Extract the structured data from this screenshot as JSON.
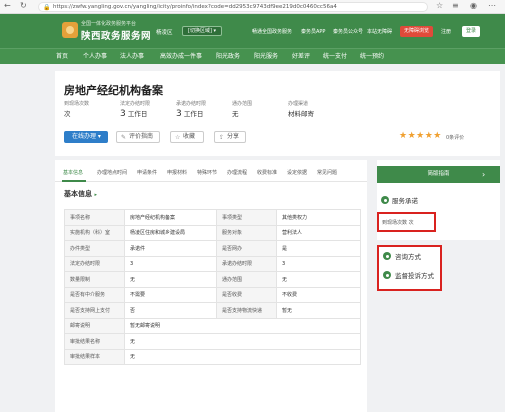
{
  "browser": {
    "url": "https://zwfw.yangling.gov.cn/yangling/icity/proinfo/index?code=dd2953c9743df9ee219d0c0460cc56a4",
    "back_icon": "arrow-left-icon",
    "refresh_icon": "refresh-icon"
  },
  "header": {
    "site_subtitle": "全国一体化政务服务平台",
    "site_name": "陕西政务服务网",
    "region": "杨凌区",
    "region_switch": "[切换区域] ▾",
    "links": [
      "畅通全国政务服务",
      "秦务员APP",
      "秦务员公众号",
      "本站无障碍"
    ],
    "alert_button": "无障碍浏览",
    "register": "注册",
    "login": "登录",
    "brand_color": "#3f8a4a"
  },
  "nav": {
    "items": [
      "首页",
      "个人办事",
      "法人办事",
      "高效办成一件事",
      "阳光政务",
      "阳光服务",
      "好差评",
      "统一支付",
      "统一预约"
    ]
  },
  "item": {
    "title": "房地产经纪机构备案",
    "stats": [
      {
        "label": "到现场次数",
        "value": "",
        "unit": "次"
      },
      {
        "label": "法定办结时限",
        "value": "3",
        "unit": "工作日"
      },
      {
        "label": "承诺办结时限",
        "value": "3",
        "unit": "工作日"
      },
      {
        "label": "通办范围",
        "value": "",
        "unit": "无"
      },
      {
        "label": "办理渠道",
        "value": "",
        "unit": "材料邮寄"
      }
    ],
    "buttons": {
      "online": "在线办理 ▾",
      "evaluate": "评价指南",
      "favorite": "收藏",
      "share": "分享"
    },
    "stars": "★★★★★",
    "rating_text": "0条评价"
  },
  "tabs": [
    "基本信息",
    "办理地点时间",
    "申请条件",
    "申报材料",
    "特殊环节",
    "办理流程",
    "收费标准",
    "设定依据",
    "常见问题"
  ],
  "basic_info": {
    "title": "基本信息",
    "rows": [
      [
        "事项名称",
        "房地产经纪机构备案",
        "事项类型",
        "其他类权力"
      ],
      [
        "实施机构（科）室",
        "杨凌区住房和城乡建设局",
        "服务对象",
        "营利法人"
      ],
      [
        "办件类型",
        "承诺件",
        "是否网办",
        "是"
      ],
      [
        "法定办结时限",
        "3",
        "承诺办结时限",
        "3"
      ],
      [
        "数量限制",
        "无",
        "通办范围",
        "无"
      ],
      [
        "是否有中介服务",
        "不需要",
        "是否收费",
        "不收费"
      ],
      [
        "是否支持网上支付",
        "否",
        "是否支持物流快递",
        "暂无"
      ],
      [
        "邮寄说明",
        "暂无邮寄说明",
        "",
        ""
      ],
      [
        "审批结果名称",
        "无",
        "",
        ""
      ],
      [
        "审批结果样本",
        "无",
        "",
        ""
      ]
    ]
  },
  "sidebar": {
    "guide": "简版指南",
    "service_title": "服务承诺",
    "visit_text": "到现场次数 次",
    "consult": "咨询方式",
    "complaint": "监督投诉方式"
  }
}
